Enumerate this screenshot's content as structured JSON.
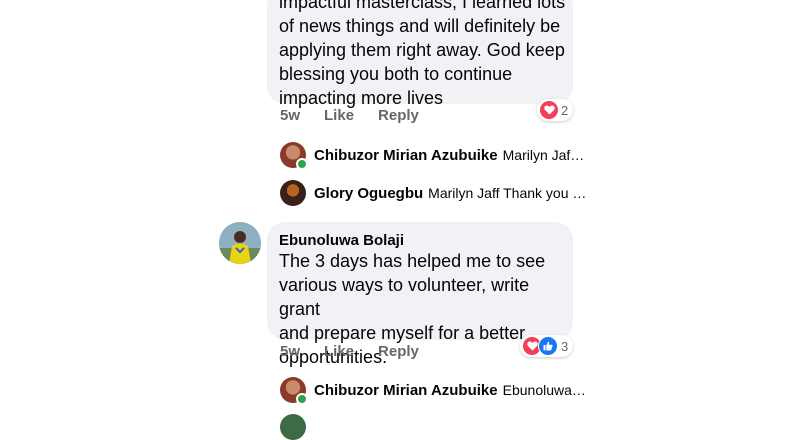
{
  "comment1": {
    "lines": [
      "impactful masterclass, I learned lots",
      "of news things and will definitely be",
      "applying them right away. God keep",
      "blessing you both to continue",
      "impacting more lives"
    ],
    "time": "5w",
    "like_label": "Like",
    "reply_label": "Reply",
    "reaction_count": "2",
    "reaction_icons": [
      "heart-icon"
    ]
  },
  "replies1": [
    {
      "name": "Chibuzor Mirian Azubuike",
      "preview": "Marilyn Jaf…",
      "online": true
    },
    {
      "name": "Glory Oguegbu",
      "preview": "Marilyn Jaff Thank you …",
      "online": false
    }
  ],
  "comment2": {
    "author": "Ebunoluwa Bolaji",
    "lines": [
      "The 3 days has helped me to see",
      "various ways to volunteer, write grant",
      "and prepare myself for a better",
      "opportunities."
    ],
    "time": "5w",
    "like_label": "Like",
    "reply_label": "Reply",
    "reaction_count": "3",
    "reaction_icons": [
      "heart-icon",
      "thumbs-up-icon"
    ]
  },
  "replies2": [
    {
      "name": "Chibuzor Mirian Azubuike",
      "preview": "Ebunoluwa…",
      "online": true
    }
  ],
  "colors": {
    "bubble": "#f0f2f5",
    "secondary_text": "#65676b",
    "heart": "#f33e58",
    "like": "#1877f2",
    "online": "#31a24c"
  }
}
